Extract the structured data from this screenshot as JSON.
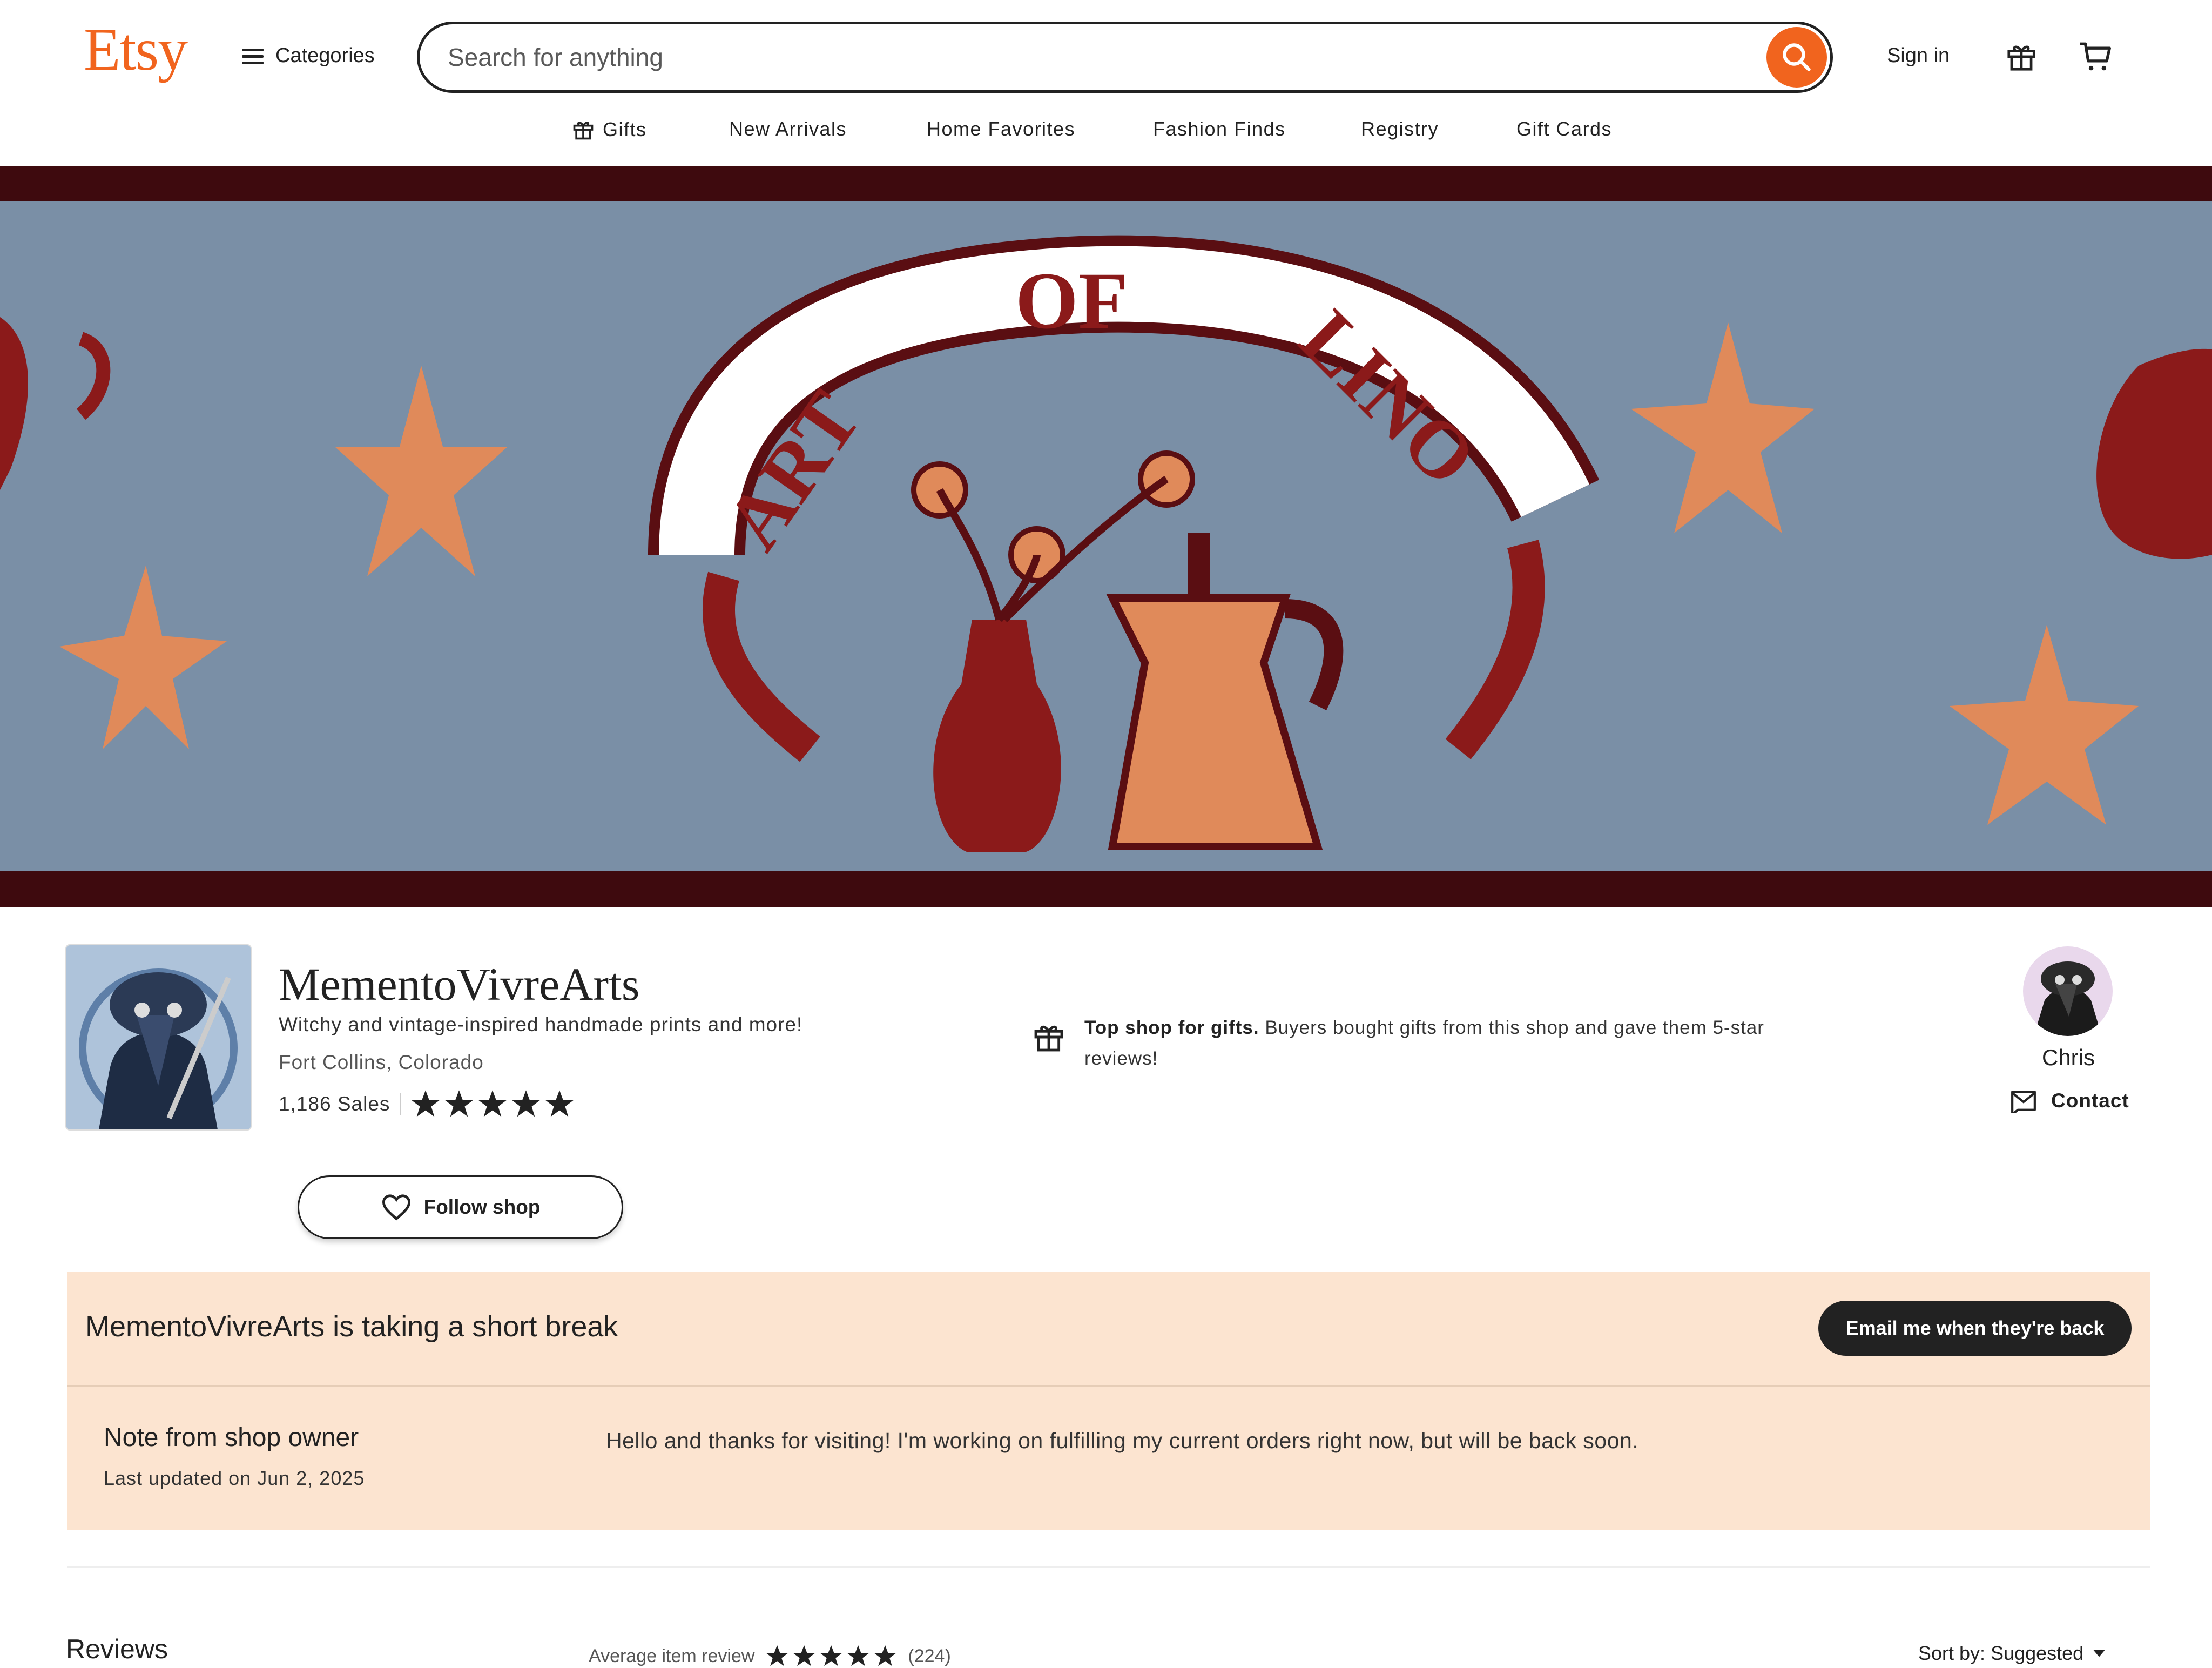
{
  "header": {
    "logo": "Etsy",
    "categories_label": "Categories",
    "search_placeholder": "Search for anything",
    "sign_in": "Sign in"
  },
  "subnav": [
    {
      "label": "Gifts"
    },
    {
      "label": "New Arrivals"
    },
    {
      "label": "Home Favorites"
    },
    {
      "label": "Fashion Finds"
    },
    {
      "label": "Registry"
    },
    {
      "label": "Gift Cards"
    }
  ],
  "banner": {
    "text_words": [
      "ART",
      "OF",
      "LINO"
    ],
    "colors": {
      "background": "#7A8FA6",
      "border": "#3E0A0E",
      "accent": "#E08A5A",
      "ink": "#8B1A1A"
    }
  },
  "shop": {
    "name": "MementoVivreArts",
    "tagline": "Witchy and vintage-inspired handmade prints and more!",
    "location": "Fort Collins, Colorado",
    "sales": "1,186 Sales",
    "rating_stars": 5,
    "follow_label": "Follow shop",
    "top_shop_bold": "Top shop for gifts.",
    "top_shop_text": "Buyers bought gifts from this shop and gave them 5-star reviews!"
  },
  "owner": {
    "name": "Chris",
    "contact_label": "Contact"
  },
  "break_notice": {
    "title": "MementoVivreArts is taking a short break",
    "email_button": "Email me when they're back",
    "note_title": "Note from shop owner",
    "note_date": "Last updated on Jun 2, 2025",
    "note_body": "Hello and thanks for visiting! I'm working on fulfilling my current orders right now, but will be back soon."
  },
  "reviews": {
    "heading": "Reviews",
    "average_label": "Average item review",
    "count": "(224)",
    "sort_label": "Sort by: Suggested"
  },
  "colors": {
    "brand": "#F1641E",
    "notice_bg": "#FCE4D0",
    "dark_button": "#222222"
  }
}
